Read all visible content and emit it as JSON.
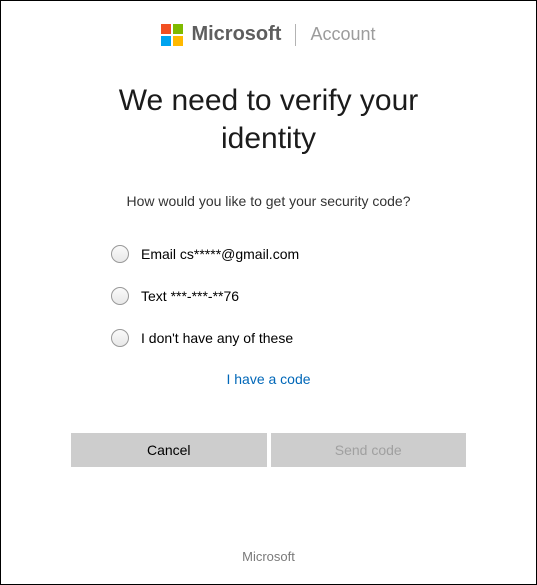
{
  "header": {
    "brand": "Microsoft",
    "section": "Account"
  },
  "title": "We need to verify your identity",
  "subtitle": "How would you like to get your security code?",
  "options": [
    {
      "label": "Email cs*****@gmail.com"
    },
    {
      "label": "Text ***-***-**76"
    },
    {
      "label": "I don't have any of these"
    }
  ],
  "have_code_label": "I have a code",
  "buttons": {
    "cancel": "Cancel",
    "send": "Send code"
  },
  "footer": "Microsoft"
}
